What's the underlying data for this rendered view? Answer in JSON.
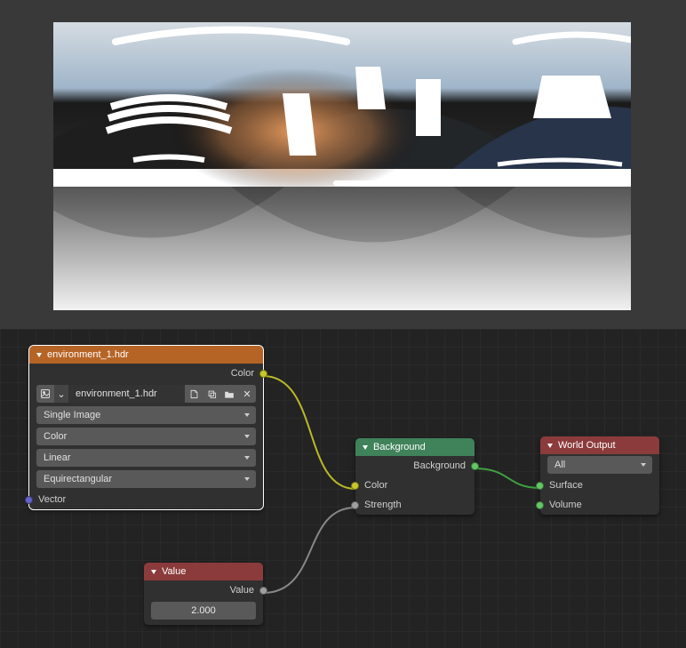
{
  "nodes": {
    "env": {
      "title": "environment_1.hdr",
      "out_color": "Color",
      "filename": "environment_1.hdr",
      "source": "Single Image",
      "colorspace": "Color",
      "interpolation": "Linear",
      "projection": "Equirectangular",
      "in_vector": "Vector"
    },
    "bg": {
      "title": "Background",
      "out_bg": "Background",
      "in_color": "Color",
      "in_strength": "Strength"
    },
    "value": {
      "title": "Value",
      "out_value": "Value",
      "number": "2.000"
    },
    "world": {
      "title": "World Output",
      "target": "All",
      "in_surface": "Surface",
      "in_volume": "Volume"
    }
  },
  "icons": {
    "image": "🖼",
    "new": "+",
    "duplicate": "❐",
    "open": "📂",
    "unlink": "✕",
    "chevdown": "⌄"
  }
}
